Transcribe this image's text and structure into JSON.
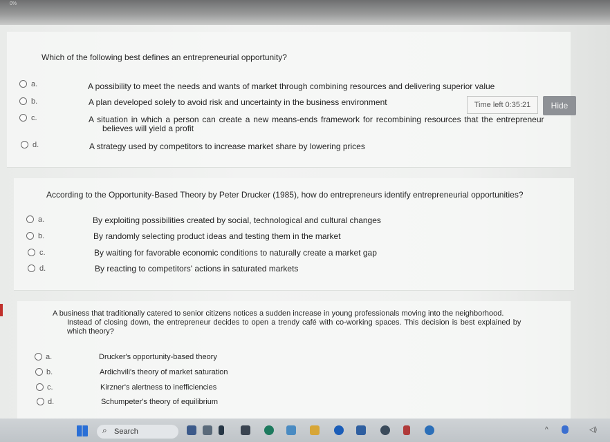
{
  "browser": {
    "progress_label": "0%"
  },
  "timer": {
    "label": "Time left 0:35:21",
    "hide_label": "Hide"
  },
  "questions": [
    {
      "text": "Which of the following best defines an entrepreneurial opportunity?",
      "options": [
        {
          "letter": "a.",
          "text": "A possibility to meet the needs and wants of market through combining resources and delivering superior value"
        },
        {
          "letter": "b.",
          "text": "A plan developed solely to avoid risk and uncertainty in the business environment"
        },
        {
          "letter": "c.",
          "text": "A situation in which a person can create a new means-ends framework for recombining resources that the entrepreneur",
          "text2": "believes will yield a profit"
        },
        {
          "letter": "d.",
          "text": "A strategy used by competitors to increase market share by lowering prices"
        }
      ]
    },
    {
      "text": "According to the Opportunity-Based Theory by Peter Drucker (1985), how do entrepreneurs identify entrepreneurial opportunities?",
      "options": [
        {
          "letter": "a.",
          "text": "By exploiting possibilities created by social, technological and cultural changes"
        },
        {
          "letter": "b.",
          "text": "By randomly selecting product ideas and testing them in the market"
        },
        {
          "letter": "c.",
          "text": "By waiting for favorable economic conditions to naturally create a market gap"
        },
        {
          "letter": "d.",
          "text": "By reacting to competitors' actions in saturated markets"
        }
      ]
    },
    {
      "text": "A business that traditionally catered to senior citizens notices a sudden increase in young professionals moving into the neighborhood.",
      "text2": "Instead of closing down, the entrepreneur decides to open a trendy café with co-working spaces. This decision is best explained by",
      "text3": "which theory?",
      "options": [
        {
          "letter": "a.",
          "text": "Drucker's opportunity-based theory"
        },
        {
          "letter": "b.",
          "text": "Ardichvili's theory of market saturation"
        },
        {
          "letter": "c.",
          "text": "Kirzner's alertness to inefficiencies"
        },
        {
          "letter": "d.",
          "text": "Schumpeter's theory of equilibrium"
        }
      ]
    }
  ],
  "taskbar": {
    "search_label": "Search"
  }
}
